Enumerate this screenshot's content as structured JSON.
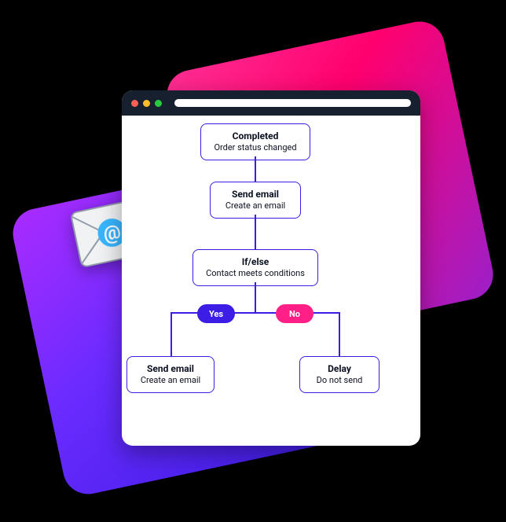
{
  "decor": {
    "mail_at_symbol": "@"
  },
  "flow": {
    "n1": {
      "title": "Completed",
      "sub": "Order status changed"
    },
    "n2": {
      "title": "Send email",
      "sub": "Create an email"
    },
    "n3": {
      "title": "If/else",
      "sub": "Contact meets conditions"
    },
    "yes": "Yes",
    "no": "No",
    "n4": {
      "title": "Send email",
      "sub": "Create an email"
    },
    "n5": {
      "title": "Delay",
      "sub": "Do not send"
    }
  },
  "colors": {
    "border": "#3b1de6",
    "yes_pill": "#3b1de6",
    "no_pill": "#ff1f87"
  }
}
